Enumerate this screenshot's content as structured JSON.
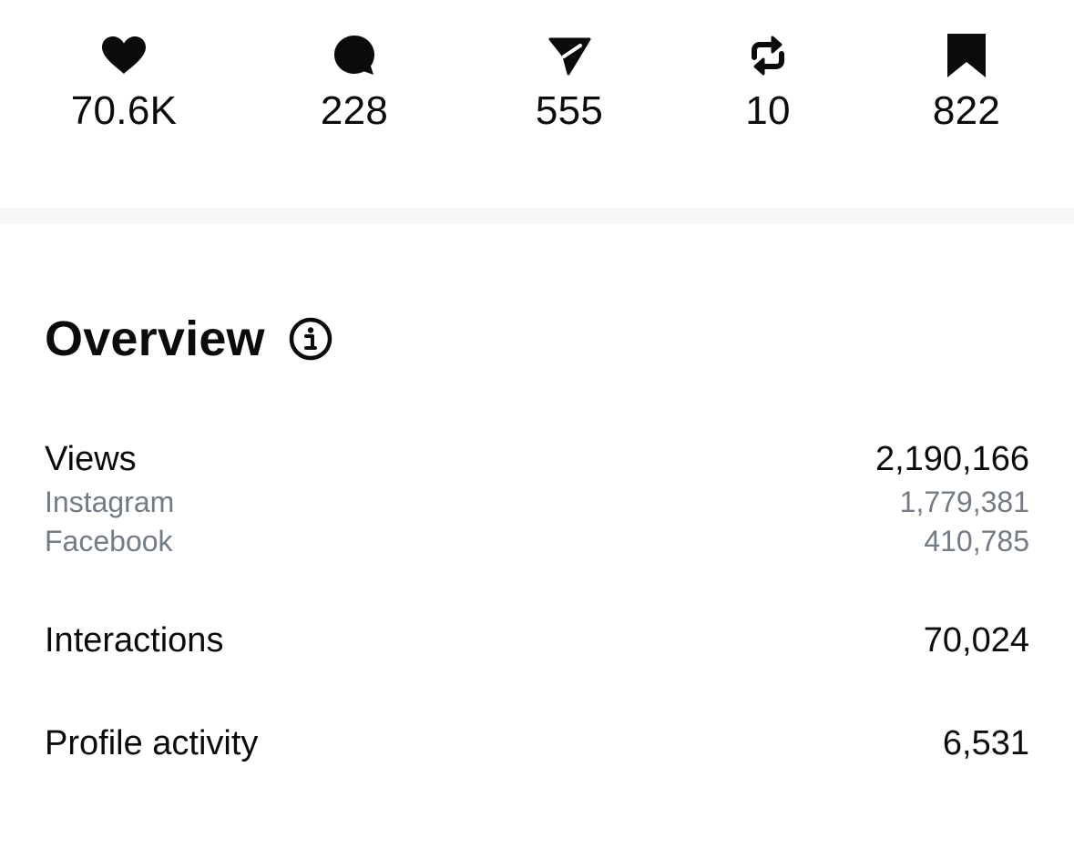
{
  "stats": [
    {
      "icon": "heart-icon",
      "count": "70.6K"
    },
    {
      "icon": "comment-icon",
      "count": "228"
    },
    {
      "icon": "share-icon",
      "count": "555"
    },
    {
      "icon": "repost-icon",
      "count": "10"
    },
    {
      "icon": "bookmark-icon",
      "count": "822"
    }
  ],
  "overview": {
    "title": "Overview",
    "info_icon": "info-icon",
    "views": {
      "label": "Views",
      "value": "2,190,166"
    },
    "instagram": {
      "label": "Instagram",
      "value": "1,779,381"
    },
    "facebook": {
      "label": "Facebook",
      "value": "410,785"
    },
    "interactions": {
      "label": "Interactions",
      "value": "70,024"
    },
    "profile_activity": {
      "label": "Profile activity",
      "value": "6,531"
    }
  },
  "colors": {
    "text": "#0b0b0c",
    "secondary_text": "#737b84",
    "divider": "#f5f6f6",
    "background": "#ffffff"
  }
}
